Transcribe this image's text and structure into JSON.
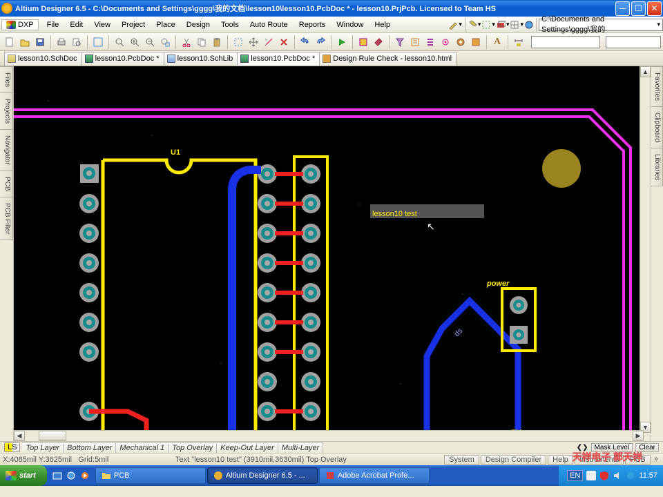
{
  "titlebar": {
    "text": "Altium Designer 6.5 - C:\\Documents and Settings\\gggg\\我的文档\\lesson10\\lesson10.PcbDoc * - lesson10.PrjPcb. Licensed to Team HS"
  },
  "menubar": {
    "dxp": "DXP",
    "items": [
      "File",
      "Edit",
      "View",
      "Project",
      "Place",
      "Design",
      "Tools",
      "Auto Route",
      "Reports",
      "Window",
      "Help"
    ],
    "path": "C:\\Documents and Settings\\gggg\\我的"
  },
  "doctabs": [
    {
      "label": "lesson10.SchDoc",
      "icon": "ico-sch",
      "active": false
    },
    {
      "label": "lesson10.PcbDoc *",
      "icon": "ico-pcb",
      "active": false
    },
    {
      "label": "lesson10.SchLib",
      "icon": "ico-lib",
      "active": false
    },
    {
      "label": "lesson10.PcbDoc *",
      "icon": "ico-pcb",
      "active": true
    },
    {
      "label": "Design Rule Check - lesson10.html",
      "icon": "ico-drc",
      "active": false
    }
  ],
  "left_tabs": [
    "Files",
    "Projects",
    "Navigator",
    "PCB",
    "PCB Filter"
  ],
  "right_tabs": [
    "Favorites",
    "Clipboard",
    "Libraries"
  ],
  "pcb": {
    "designators": {
      "u1": "U1",
      "power": "power",
      "fm": "FM"
    },
    "text_string": "lesson10 test"
  },
  "layer_tabs": {
    "ls": "LS",
    "tabs": [
      "Top Layer",
      "Bottom Layer",
      "Mechanical 1",
      "Top Overlay",
      "Keep-Out Layer",
      "Multi-Layer"
    ],
    "mask_level": "Mask Level",
    "clear": "Clear"
  },
  "status": {
    "coords": "X:4085mil Y:3625mil",
    "grid": "Grid:5mil",
    "sel": "Text \"lesson10 test\" (3910mil,3630mil)  Top Overlay",
    "buttons": [
      "System",
      "Design Compiler",
      "Help",
      "Instruments",
      "PCB"
    ]
  },
  "taskbar": {
    "start": "start",
    "tasks": [
      {
        "label": "PCB",
        "icon": "#f0d050"
      },
      {
        "label": "Altium Designer 6.5 - ...",
        "icon": "#e8b030",
        "active": true
      },
      {
        "label": "Adobe Acrobat Profe...",
        "icon": "#d04040"
      }
    ],
    "lang": "EN",
    "clock": "11:57"
  },
  "watermark": "天祥电子 郭天祥"
}
